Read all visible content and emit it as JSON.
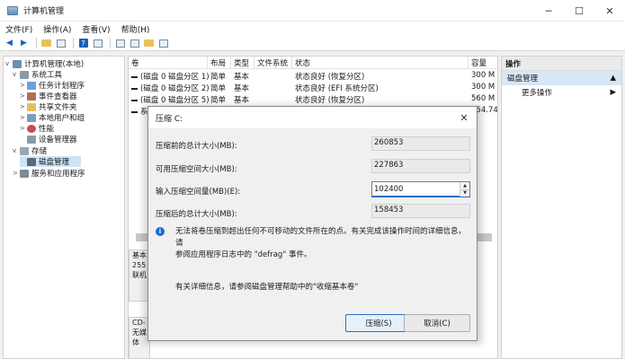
{
  "window": {
    "title": "计算机管理"
  },
  "menu": [
    "文件(F)",
    "操作(A)",
    "查看(V)",
    "帮助(H)"
  ],
  "tree": [
    {
      "label": "计算机管理(本地)",
      "indent": 0,
      "arrow": "v",
      "icon": "computer-icon"
    },
    {
      "label": "系统工具",
      "indent": 1,
      "arrow": "v",
      "icon": "tools-icon"
    },
    {
      "label": "任务计划程序",
      "indent": 2,
      "arrow": ">",
      "icon": "clock-icon"
    },
    {
      "label": "事件查看器",
      "indent": 2,
      "arrow": ">",
      "icon": "event-icon"
    },
    {
      "label": "共享文件夹",
      "indent": 2,
      "arrow": ">",
      "icon": "folder-icon"
    },
    {
      "label": "本地用户和组",
      "indent": 2,
      "arrow": ">",
      "icon": "users-icon"
    },
    {
      "label": "性能",
      "indent": 2,
      "arrow": ">",
      "icon": "performance-icon"
    },
    {
      "label": "设备管理器",
      "indent": 2,
      "arrow": "",
      "icon": "device-icon"
    },
    {
      "label": "存储",
      "indent": 1,
      "arrow": "v",
      "icon": "storage-icon"
    },
    {
      "label": "磁盘管理",
      "indent": 2,
      "arrow": "",
      "icon": "disk-icon",
      "selected": true
    },
    {
      "label": "服务和应用程序",
      "indent": 1,
      "arrow": ">",
      "icon": "services-icon"
    }
  ],
  "columns": [
    "卷",
    "布局",
    "类型",
    "文件系统",
    "状态",
    "容量"
  ],
  "volumes": [
    {
      "name": "(磁盘 0 磁盘分区 1)",
      "layout": "简单",
      "type": "基本",
      "fs": "",
      "status": "状态良好 (恢复分区)",
      "size": "300 M"
    },
    {
      "name": "(磁盘 0 磁盘分区 2)",
      "layout": "简单",
      "type": "基本",
      "fs": "",
      "status": "状态良好 (EFI 系统分区)",
      "size": "300 M"
    },
    {
      "name": "(磁盘 0 磁盘分区 5)",
      "layout": "简单",
      "type": "基本",
      "fs": "",
      "status": "状态良好 (恢复分区)",
      "size": "560 M"
    },
    {
      "name": "系",
      "layout": "",
      "type": "",
      "fs": "",
      "status": "",
      "size": "254.74"
    }
  ],
  "disk_panel": {
    "l1": "基本",
    "l2": "255",
    "l3": "联机"
  },
  "disk_panel2": {
    "l1": "CD-",
    "l2": "无媒体"
  },
  "actions": {
    "header": "操作",
    "section": "磁盘管理",
    "more": "更多操作"
  },
  "dialog": {
    "title": "压缩 C:",
    "total_label": "压缩前的总计大小(MB):",
    "total_value": "260853",
    "available_label": "可用压缩空间大小(MB):",
    "available_value": "227863",
    "input_label": "输入压缩空间量(MB)(E):",
    "input_value": "102400",
    "after_label": "压缩后的总计大小(MB):",
    "after_value": "158453",
    "info_line1": "无法将卷压缩到超出任何不可移动的文件所在的点。有关完成该操作时间的详细信息，请",
    "info_line2": "参阅应用程序日志中的 \"defrag\" 事件。",
    "more_info": "有关详细信息，请参阅磁盘管理帮助中的\"收缩基本卷\"",
    "ok": "压缩(S)",
    "cancel": "取消(C)"
  }
}
